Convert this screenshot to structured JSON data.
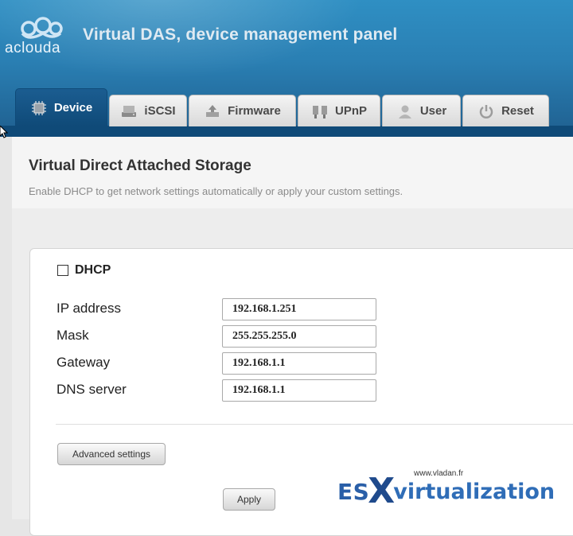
{
  "header": {
    "logo_text": "aclouda",
    "title": "Virtual DAS, device management panel"
  },
  "tabs": [
    {
      "label": "Device",
      "icon": "chip-icon",
      "active": true
    },
    {
      "label": "iSCSI",
      "icon": "drive-icon",
      "active": false
    },
    {
      "label": "Firmware",
      "icon": "chip-upload-icon",
      "active": false
    },
    {
      "label": "UPnP",
      "icon": "plug-icon",
      "active": false
    },
    {
      "label": "User",
      "icon": "user-icon",
      "active": false
    },
    {
      "label": "Reset",
      "icon": "power-icon",
      "active": false
    }
  ],
  "section": {
    "title": "Virtual Direct Attached Storage",
    "description": "Enable DHCP to get network settings automatically or apply your custom settings."
  },
  "form": {
    "dhcp_label": "DHCP",
    "dhcp_checked": false,
    "fields": [
      {
        "label": "IP address",
        "value": "192.168.1.251"
      },
      {
        "label": "Mask",
        "value": "255.255.255.0"
      },
      {
        "label": "Gateway",
        "value": "192.168.1.1"
      },
      {
        "label": "DNS server",
        "value": "192.168.1.1"
      }
    ],
    "advanced_label": "Advanced settings",
    "apply_label": "Apply"
  },
  "watermark": {
    "url": "www.vladan.fr",
    "es": "ES",
    "x": "X",
    "rest": "virtualization"
  },
  "colors": {
    "header": "#2a7fb3",
    "tab_active": "#0f4a78",
    "watermark": "#2a5fa8"
  }
}
